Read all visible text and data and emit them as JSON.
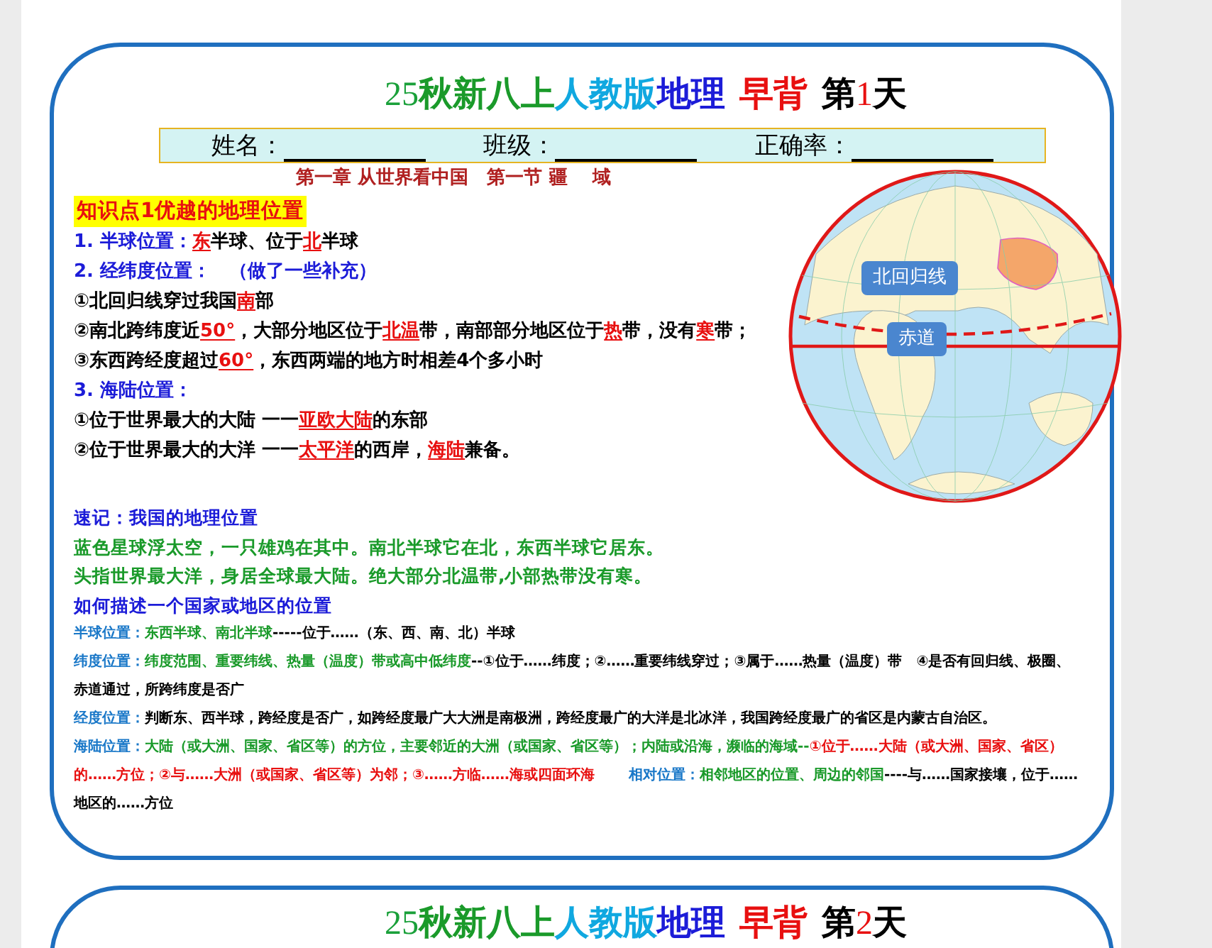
{
  "cards": [
    {
      "title": [
        {
          "kind": "serif-green",
          "text": "25"
        },
        {
          "kind": "green",
          "text": "秋新八上"
        },
        {
          "kind": "cyan",
          "text": "人教版"
        },
        {
          "kind": "blue",
          "text": "地理"
        },
        {
          "kind": "red",
          "text": "早背"
        },
        {
          "kind": "black",
          "text": "第"
        },
        {
          "kind": "serif-red",
          "text": "1"
        },
        {
          "kind": "black",
          "text": "天"
        }
      ],
      "header_fields": [
        {
          "label": "姓名："
        },
        {
          "label": "班级："
        },
        {
          "label": "正确率："
        }
      ],
      "chapter": "第一章 从世界看中国　第一节 疆　 域",
      "section_title": "知识点1优越的地理位置",
      "globe_labels": [
        "北回归线",
        "赤道"
      ],
      "points": [
        {
          "kind": "main",
          "segments": [
            {
              "kind": "blue",
              "text": "1. 半球位置："
            },
            {
              "kind": "answer",
              "text": "东"
            },
            {
              "kind": "black",
              "text": "半球、位于"
            },
            {
              "kind": "answer",
              "text": "北"
            },
            {
              "kind": "black",
              "text": "半球"
            }
          ]
        },
        {
          "kind": "main",
          "segments": [
            {
              "kind": "blue",
              "text": "2. 经纬度位置：　（做了一些补充）"
            }
          ]
        },
        {
          "kind": "main",
          "segments": [
            {
              "kind": "black",
              "text": "①北回归线穿过我国"
            },
            {
              "kind": "answer",
              "text": "南"
            },
            {
              "kind": "black",
              "text": "部"
            }
          ]
        },
        {
          "kind": "main",
          "segments": [
            {
              "kind": "black",
              "text": "②南北跨纬度近"
            },
            {
              "kind": "answer",
              "text": "50°"
            },
            {
              "kind": "black",
              "text": "，大部分地区位于"
            },
            {
              "kind": "answer",
              "text": "北温"
            },
            {
              "kind": "black",
              "text": "带，南部部分地区位于"
            },
            {
              "kind": "answer",
              "text": "热"
            },
            {
              "kind": "black",
              "text": "带，没有"
            },
            {
              "kind": "answer",
              "text": "寒"
            },
            {
              "kind": "black",
              "text": "带；"
            }
          ]
        },
        {
          "kind": "main",
          "segments": [
            {
              "kind": "black",
              "text": "③东西跨经度超过"
            },
            {
              "kind": "answer",
              "text": "60°"
            },
            {
              "kind": "black",
              "text": "，东西两端的地方时相差4个多小时"
            }
          ]
        },
        {
          "kind": "main",
          "segments": [
            {
              "kind": "blue",
              "text": "3. 海陆位置："
            }
          ]
        },
        {
          "kind": "main",
          "segments": [
            {
              "kind": "black",
              "text": "①位于世界最大的大陆 一一"
            },
            {
              "kind": "answer",
              "text": "亚欧大陆"
            },
            {
              "kind": "black",
              "text": "的东部"
            }
          ]
        },
        {
          "kind": "main",
          "segments": [
            {
              "kind": "black",
              "text": "②位于世界最大的大洋 一一"
            },
            {
              "kind": "answer",
              "text": "太平洋"
            },
            {
              "kind": "black",
              "text": "的西岸，"
            },
            {
              "kind": "answer",
              "text": "海陆"
            },
            {
              "kind": "black",
              "text": "兼备。"
            }
          ]
        }
      ],
      "notes": [
        {
          "kind": "note",
          "segments": [
            {
              "kind": "blue",
              "text": "速记：我国的地理位置"
            }
          ]
        },
        {
          "kind": "note",
          "segments": [
            {
              "kind": "green",
              "text": "蓝色星球浮太空，一只雄鸡在其中。南北半球它在北，东西半球它居东。"
            }
          ]
        },
        {
          "kind": "note",
          "segments": [
            {
              "kind": "green",
              "text": "头指世界最大洋，身居全球最大陆。绝大部分北温带,小部热带没有寒。"
            }
          ]
        },
        {
          "kind": "note",
          "segments": [
            {
              "kind": "blue",
              "text": "如何描述一个国家或地区的位置"
            }
          ]
        },
        {
          "kind": "detail",
          "segments": [
            {
              "kind": "sky",
              "text": "半球位置："
            },
            {
              "kind": "green",
              "text": "东西半球、南北半球"
            },
            {
              "kind": "black",
              "text": "-----位于……（东、西、南、北）半球"
            }
          ]
        },
        {
          "kind": "detail",
          "segments": [
            {
              "kind": "sky",
              "text": "纬度位置："
            },
            {
              "kind": "green",
              "text": "纬度范围、重要纬线、热量（温度）带或高中低纬度"
            },
            {
              "kind": "black",
              "text": "--①位于……纬度；②……重要纬线穿过；③属于……热量（温度）带　④是否有回归线、极圈、赤道通过，所跨纬度是否广"
            }
          ]
        },
        {
          "kind": "detail",
          "segments": [
            {
              "kind": "sky",
              "text": "经度位置："
            },
            {
              "kind": "black",
              "text": "判断东、西半球，跨经度是否广，如跨经度最广大大洲是南极洲，跨经度最广的大洋是北冰洋，我国跨经度最广的省区是内蒙古自治区。"
            }
          ]
        },
        {
          "kind": "detail",
          "segments": [
            {
              "kind": "sky",
              "text": "海陆位置："
            },
            {
              "kind": "green",
              "text": "大陆（或大洲、国家、省区等）的方位，主要邻近的大洲（或国家、省区等）；内陆或沿海，濒临的海域--"
            },
            {
              "kind": "red",
              "text": "①位于……大陆（或大洲、国家、省区）的……方位；②与……大洲（或国家、省区等）为邻；③……方临……海或四面环海"
            },
            {
              "kind": "sky",
              "text": "相对位置："
            },
            {
              "kind": "green",
              "text": "相邻地区的位置、周边的邻国"
            },
            {
              "kind": "black",
              "text": "----与……国家接壤，位于……地区的……方位"
            }
          ]
        }
      ]
    },
    {
      "title": [
        {
          "kind": "serif-green",
          "text": "25"
        },
        {
          "kind": "green",
          "text": "秋新八上"
        },
        {
          "kind": "cyan",
          "text": "人教版"
        },
        {
          "kind": "blue",
          "text": "地理"
        },
        {
          "kind": "red",
          "text": "早背"
        },
        {
          "kind": "black",
          "text": "第"
        },
        {
          "kind": "serif-red",
          "text": "2"
        },
        {
          "kind": "black",
          "text": "天"
        }
      ]
    }
  ]
}
